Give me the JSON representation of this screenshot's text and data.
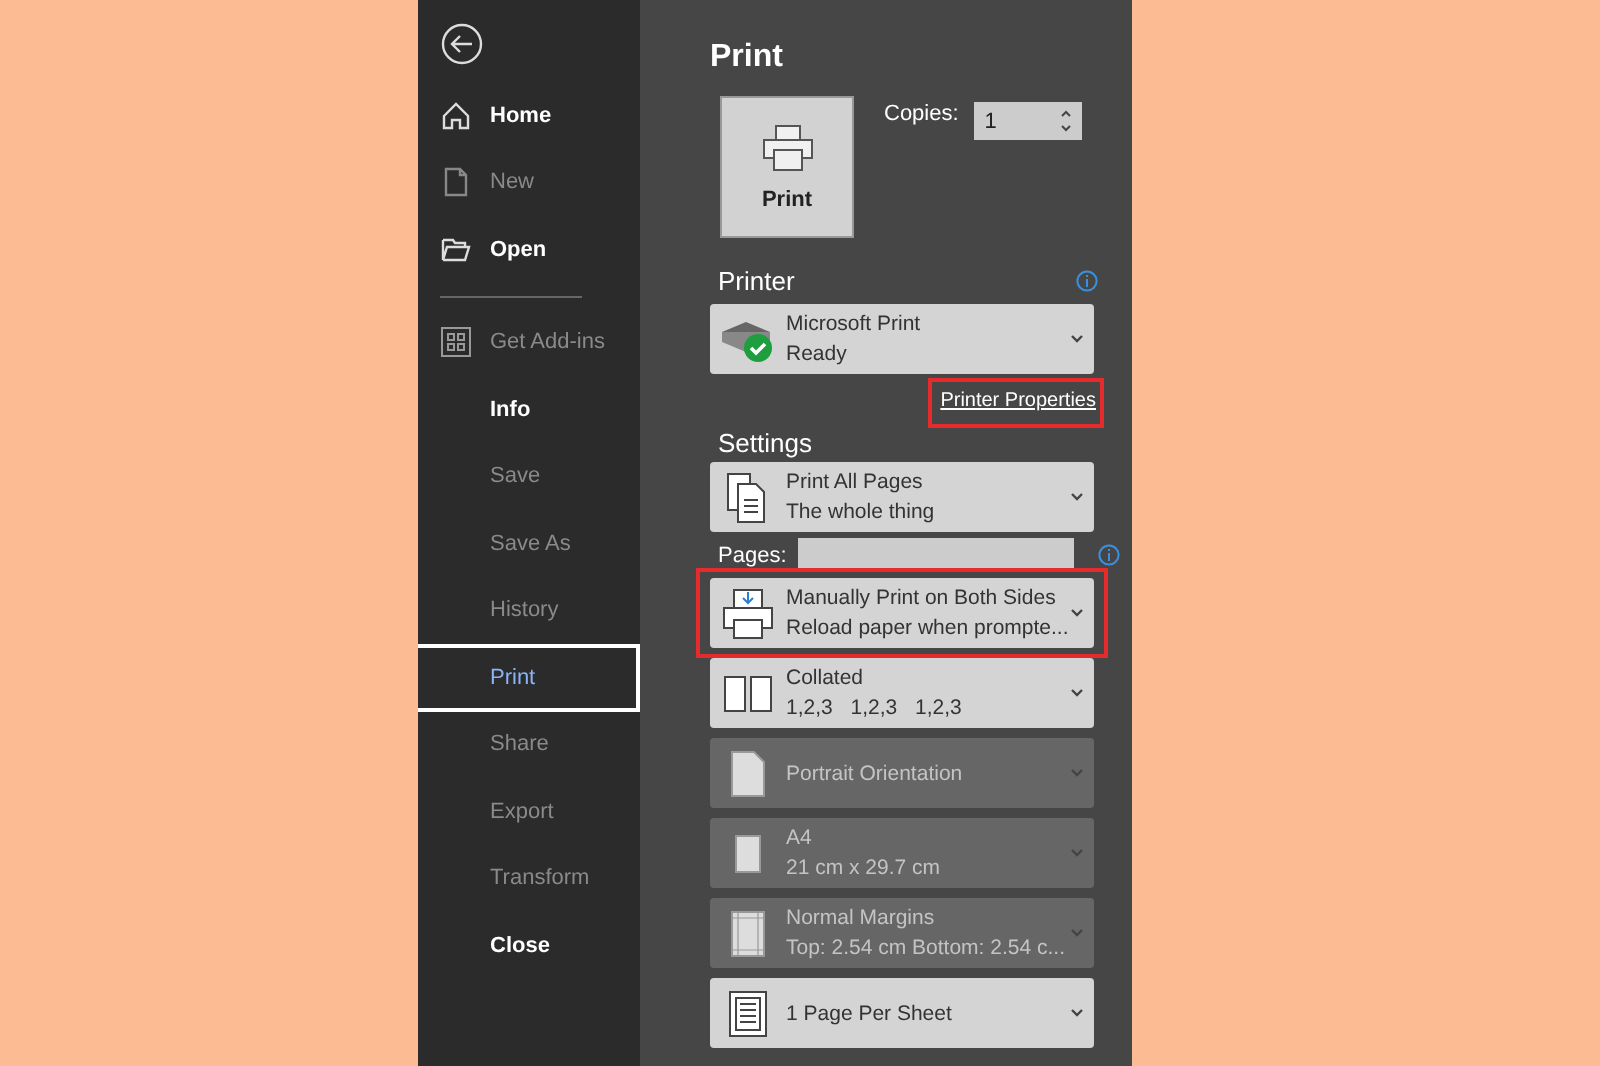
{
  "sidebar": {
    "groups": [
      [
        {
          "kind": "home",
          "label": "Home",
          "disabled": false,
          "selected": false
        },
        {
          "kind": "new",
          "label": "New",
          "disabled": true,
          "selected": false
        },
        {
          "kind": "open",
          "label": "Open",
          "disabled": false,
          "selected": false
        }
      ],
      [
        {
          "kind": "addins",
          "label": "Get Add-ins",
          "disabled": true,
          "selected": false
        },
        {
          "kind": "plain",
          "label": "Info",
          "disabled": false,
          "selected": false
        },
        {
          "kind": "plain",
          "label": "Save",
          "disabled": true,
          "selected": false
        },
        {
          "kind": "plain",
          "label": "Save As",
          "disabled": true,
          "selected": false
        },
        {
          "kind": "plain",
          "label": "History",
          "disabled": true,
          "selected": false
        },
        {
          "kind": "plain",
          "label": "Print",
          "disabled": false,
          "selected": true
        },
        {
          "kind": "plain",
          "label": "Share",
          "disabled": true,
          "selected": false
        },
        {
          "kind": "plain",
          "label": "Export",
          "disabled": true,
          "selected": false
        },
        {
          "kind": "plain",
          "label": "Transform",
          "disabled": true,
          "selected": false
        },
        {
          "kind": "plain",
          "label": "Close",
          "disabled": false,
          "selected": false
        }
      ]
    ]
  },
  "panel": {
    "title": "Print",
    "print_button": "Print",
    "copies": {
      "label": "Copies:",
      "value": "1"
    },
    "printer": {
      "heading": "Printer",
      "name": "Microsoft Print",
      "status": "Ready",
      "properties_link": {
        "label": "Printer Properties",
        "highlighted": true
      }
    },
    "settings": {
      "heading": "Settings",
      "items": [
        {
          "kind": "pages",
          "line1": "Print All Pages",
          "line2": "The whole thing",
          "disabled": false,
          "highlighted": false
        },
        {
          "kind": "pages_field",
          "label": "Pages:"
        },
        {
          "kind": "duplex",
          "line1": "Manually Print on Both Sides",
          "line2": "Reload paper when prompte...",
          "disabled": false,
          "highlighted": true
        },
        {
          "kind": "collate",
          "line1": "Collated",
          "line2": "1,2,3 1,2,3 1,2,3",
          "disabled": false,
          "highlighted": false
        },
        {
          "kind": "orientation",
          "line1": "Portrait Orientation",
          "disabled": true,
          "highlighted": false
        },
        {
          "kind": "paper",
          "line1": "A4",
          "line2": "21 cm x 29.7 cm",
          "disabled": true,
          "highlighted": false
        },
        {
          "kind": "margins",
          "line1": "Normal Margins",
          "line2": "Top: 2.54 cm Bottom: 2.54 c...",
          "disabled": true,
          "highlighted": false
        },
        {
          "kind": "persheet",
          "line1": "1 Page Per Sheet",
          "disabled": false,
          "highlighted": false
        }
      ]
    }
  }
}
